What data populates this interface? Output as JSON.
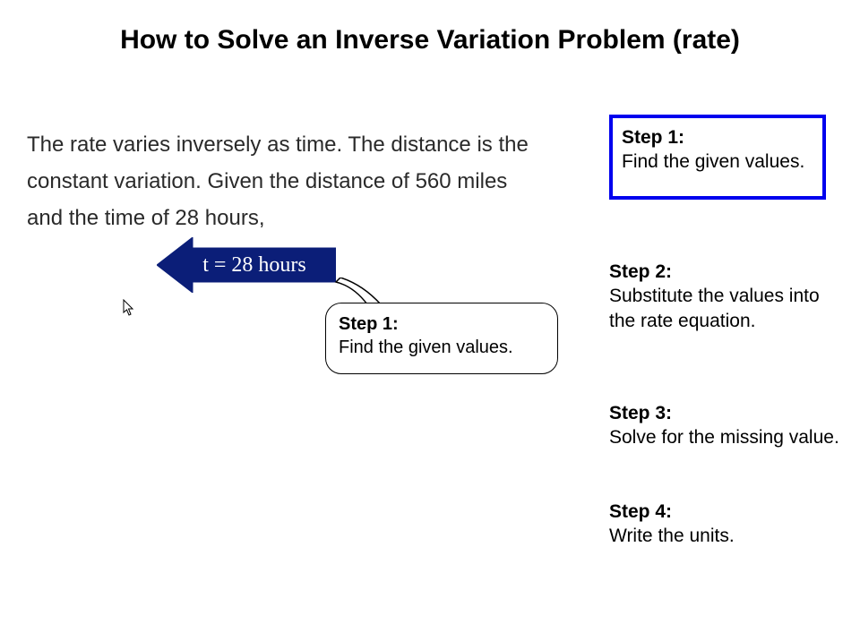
{
  "title": "How to Solve an Inverse Variation Problem (rate)",
  "problem_text": "The rate varies inversely as time.  The distance is the constant variation.  Given the distance of 560 miles and the time of 28 hours, ",
  "arrow_label": "t = 28 hours",
  "bubble": {
    "heading": "Step 1:",
    "body": "Find the given values."
  },
  "steps": {
    "s1": {
      "heading": "Step 1:",
      "body": "Find the given values."
    },
    "s2": {
      "heading": "Step 2:",
      "body": "Substitute the values into the rate equation."
    },
    "s3": {
      "heading": "Step 3:",
      "body": "Solve for the missing value."
    },
    "s4": {
      "heading": "Step 4:",
      "body": "Write the units."
    }
  },
  "colors": {
    "arrow_fill": "#0b1e78",
    "highlight_border": "#0000ee"
  }
}
